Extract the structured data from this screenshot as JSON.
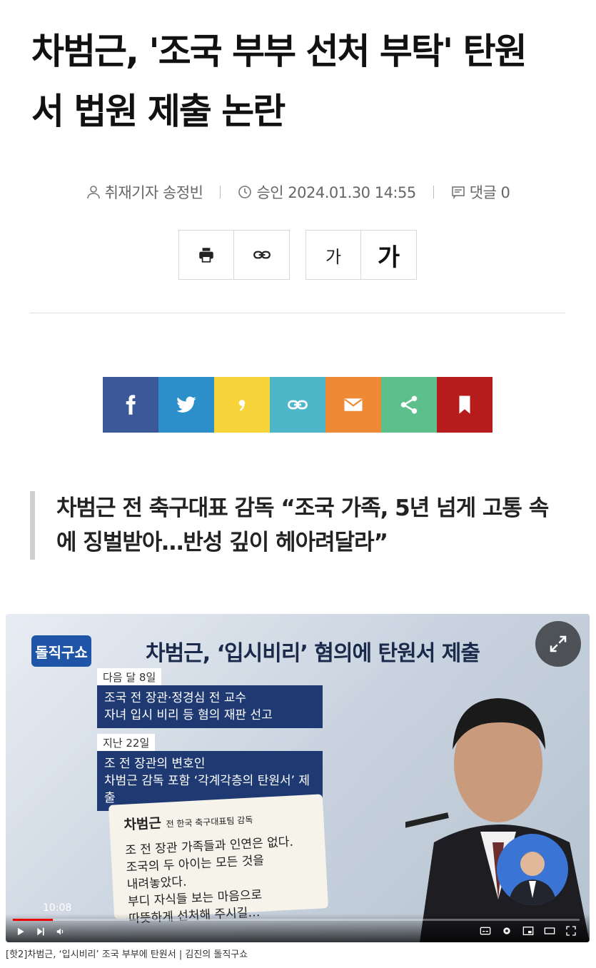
{
  "article": {
    "headline_line1": "차범근, '조국 부부 선처 부탁' 탄원",
    "headline_line2": "서 법원 제출 논란",
    "reporter": "취재기자 송정빈",
    "approved": "승인 2024.01.30 14:55",
    "comments": "댓글 0",
    "subhead_line1": "차범근 전 축구대표 감독 “조국 가족, 5년 넘게 고통 속",
    "subhead_line2": "에 징벌받아…반성 깊이 헤아려달라”"
  },
  "tools": {
    "font_small": "가",
    "font_large": "가"
  },
  "share": {
    "colors": {
      "facebook": "#3b5998",
      "twitter": "#2c8fc9",
      "kakao": "#f6d43a",
      "link": "#4db6c8",
      "email": "#ee8a36",
      "share": "#5cbf8c",
      "bookmark": "#b71c1c"
    }
  },
  "video": {
    "logo": "돌직구쇼",
    "title": "차범근, ‘입시비리’ 혐의에 탄원서 제출",
    "label1": "다음 달 8일",
    "box1_line1": "조국 전 장관·정경심 전 교수",
    "box1_line2": "자녀 입시 비리 등 혐의 재판 선고",
    "label2": "지난 22일",
    "box2_line1": "조 전 장관의 변호인",
    "box2_line2": "차범근 감독 포함 ‘각계각층의 탄원서’ 제출",
    "paper_name": "차범근",
    "paper_role": "전 한국 축구대표팀 감독",
    "paper_line1": "조 전 장관 가족들과 인연은 없다.",
    "paper_line2": "조국의 두 아이는 모든 것을",
    "paper_line3": "내려놓았다.",
    "paper_line4": "부디 자식들 보는 마음으로",
    "paper_line5": "따뜻하게 선처해 주시길…",
    "timecode": "10:08",
    "progress_fraction": 0.07,
    "caption": "[핫2]차범근, ‘입시비리’ 조국 부부에 탄원서 | 김진의 돌직구쇼"
  }
}
